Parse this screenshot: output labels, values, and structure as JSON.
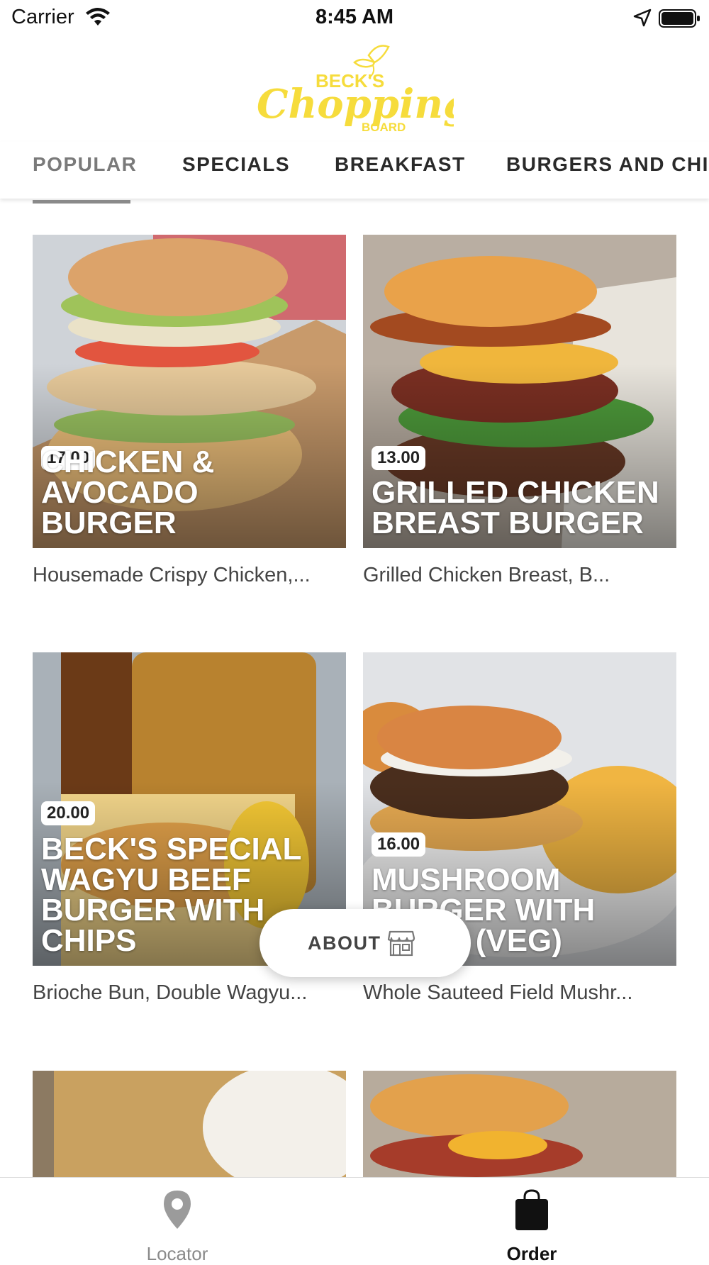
{
  "status_bar": {
    "carrier": "Carrier",
    "time": "8:45 AM"
  },
  "brand": {
    "logo_line1": "BECK'S",
    "logo_line2": "Chopping",
    "logo_line3": "BOARD",
    "color": "#F6DC3C"
  },
  "tabs": [
    {
      "label": "POPULAR",
      "active": true
    },
    {
      "label": "SPECIALS"
    },
    {
      "label": "BREAKFAST"
    },
    {
      "label": "BURGERS AND CHIPS"
    }
  ],
  "menu_items": [
    {
      "price": "17.00",
      "title": "CHICKEN & AVOCADO BURGER",
      "description": "Housemade Crispy Chicken,..."
    },
    {
      "price": "13.00",
      "title": "GRILLED CHICKEN BREAST BURGER",
      "description": "Grilled Chicken Breast, B..."
    },
    {
      "price": "20.00",
      "title": "BECK'S SPECIAL WAGYU BEEF BURGER WITH CHIPS",
      "description": "Brioche Bun, Double Wagyu..."
    },
    {
      "price": "16.00",
      "title": "MUSHROOM BURGER WITH CHIPS (VEG)",
      "description": "Whole Sauteed Field Mushr..."
    }
  ],
  "about_button": {
    "label": "ABOUT",
    "icon": "store-icon"
  },
  "bottom_nav": [
    {
      "label": "Locator",
      "icon": "map-pin-icon",
      "active": false
    },
    {
      "label": "Order",
      "icon": "shopping-bag-icon",
      "active": true
    }
  ]
}
